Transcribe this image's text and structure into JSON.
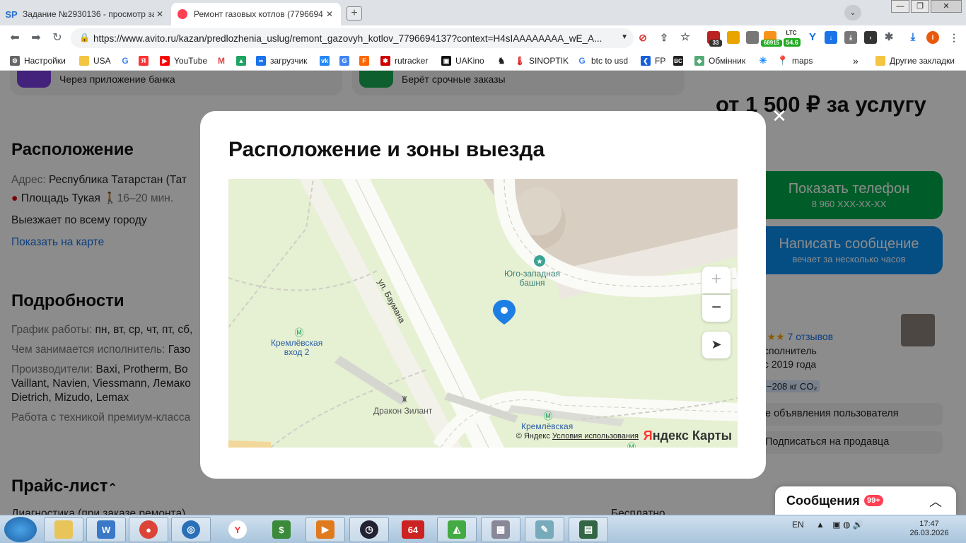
{
  "browser": {
    "tabs": [
      {
        "favicon": "SP",
        "title": "Задание №2930136 - просмотр за",
        "close": "✕"
      },
      {
        "favicon": "avito-dot",
        "title": "Ремонт газовых котлов (7796694",
        "close": "✕"
      }
    ],
    "window_buttons": {
      "minimize": "—",
      "maximize": "❐",
      "close": "✕"
    },
    "url": "https://www.avito.ru/kazan/predlozhenia_uslug/remont_gazovyh_kotlov_7796694137?context=H4sIAAAAAAAA_wE_A...",
    "extension_badges": {
      "ext1": "33",
      "ext2": "68915",
      "ext3_label": "LTC",
      "ext3_value": "54.6"
    },
    "bookmarks": [
      {
        "label": "Настройки",
        "icon": "gear-icon"
      },
      {
        "label": "USA",
        "icon": "folder-icon"
      },
      {
        "label": "",
        "icon": "google-icon"
      },
      {
        "label": "",
        "icon": "yandex-icon"
      },
      {
        "label": "YouTube",
        "icon": "youtube-icon"
      },
      {
        "label": "",
        "icon": "gmail-icon"
      },
      {
        "label": "",
        "icon": "drive-icon"
      },
      {
        "label": "загрузчик",
        "icon": "infinity-icon"
      },
      {
        "label": "",
        "icon": "vk-icon"
      },
      {
        "label": "",
        "icon": "translate-icon"
      },
      {
        "label": "",
        "icon": "f-icon"
      },
      {
        "label": "rutracker",
        "icon": "rutracker-icon"
      },
      {
        "label": "UAKino",
        "icon": "uakino-icon"
      },
      {
        "label": "",
        "icon": "chess-icon"
      },
      {
        "label": "SINOPTIK",
        "icon": "thermometer-icon"
      },
      {
        "label": "btc to usd",
        "icon": "google-icon"
      },
      {
        "label": "FP",
        "icon": "fp-icon"
      },
      {
        "label": "",
        "icon": "bc-icon"
      },
      {
        "label": "Обмінник",
        "icon": "exchange-icon"
      },
      {
        "label": "",
        "icon": "star-icon"
      },
      {
        "label": "maps",
        "icon": "maps-icon"
      }
    ],
    "bookmarks_more": "»",
    "other_bookmarks": "Другие закладки"
  },
  "page": {
    "promo_cards": [
      "Через приложение банка",
      "Берёт срочные заказы"
    ],
    "price": "от 1 500 ₽ за услугу",
    "location": {
      "heading": "Расположение",
      "address_label": "Адрес:",
      "address_value": "Республика Татарстан (Тат",
      "metro_station": "Площадь Тукая",
      "metro_time": "16–20 мин.",
      "coverage": "Выезжает по всему городу",
      "show_on_map": "Показать на карте"
    },
    "details": {
      "heading": "Подробности",
      "schedule_label": "График работы:",
      "schedule_value": "пн, вт, ср, чт, пт, сб,",
      "activity_label": "Чем занимается исполнитель:",
      "activity_value": "Газо",
      "makers_label": "Производители:",
      "makers_line1": "Baxi, Protherm, Bo",
      "makers_line2": "Vaillant, Navien, Viessmann, Лемако",
      "makers_line3": "Dietrich, Mizudo, Lemax",
      "premium": "Работа с техникой премиум-класса"
    },
    "pricelist": {
      "heading": "Прайс-лист",
      "row_label": "Диагностика (при заказе ремонта)",
      "row_value": "Бесплатно"
    },
    "sidebar": {
      "phone_button": "Показать телефон",
      "phone_number": "8 960 XXX-XX-XX",
      "message_button": "Написать сообщение",
      "message_sub": "вечает за несколько часов",
      "stars": "★★★",
      "reviews": "7 отзывов",
      "role": "сполнитель",
      "since": "с 2019 года",
      "co2": "−208 кг CO₂",
      "user_ads": "е объявления пользователя",
      "subscribe": "Подписаться на продавца"
    },
    "messages_bar": {
      "label": "Сообщения",
      "badge": "99+",
      "toggle": "︿"
    }
  },
  "modal": {
    "title": "Расположение и зоны выезда",
    "close": "✕",
    "map": {
      "labels": {
        "street": "ул. Баумана",
        "tower": "Юго-западная\nбашня",
        "metro_entrance": "Кремлёвская\nвход 2",
        "monument": "Дракон Зилант",
        "metro": "Кремлёвская"
      },
      "zoom_in": "+",
      "zoom_out": "−",
      "copyright_prefix": "© Яндекс",
      "terms": "Условия использования",
      "logo_a": "Я",
      "logo_b": "ндекс Карты"
    }
  },
  "taskbar": {
    "lang": "EN",
    "time": "17:47",
    "date": "26.03.2026",
    "apps": [
      "explorer",
      "shield",
      "chrome",
      "globe",
      "yandex-browser",
      "money",
      "player",
      "clock",
      "64",
      "apps",
      "calculator",
      "notepad",
      "monitor"
    ],
    "app_64_label": "64"
  },
  "colors": {
    "green": "#00aa4b",
    "blue": "#0a8ef0",
    "overlay": "rgba(0,0,0,0.45)",
    "map_bg": "#e9f2d8",
    "pin": "#1d7fe3"
  }
}
